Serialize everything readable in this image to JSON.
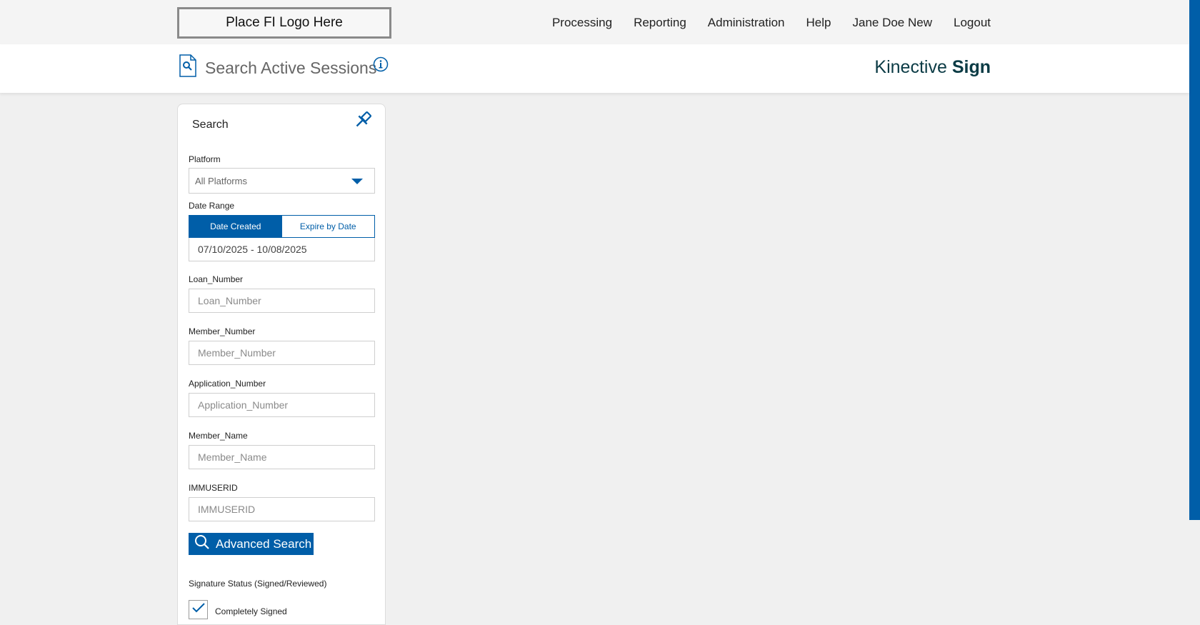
{
  "logo_text": "Place FI Logo Here",
  "nav": {
    "processing": "Processing",
    "reporting": "Reporting",
    "administration": "Administration",
    "help": "Help",
    "user": "Jane Doe New",
    "logout": "Logout"
  },
  "header": {
    "title": "Search Active Sessions",
    "brand_light": "Kinective",
    "brand_bold": "Sign"
  },
  "search_panel": {
    "title": "Search",
    "platform_label": "Platform",
    "platform_value": "All Platforms",
    "date_range_label": "Date Range",
    "date_created": "Date Created",
    "expire_by_date": "Expire by Date",
    "date_range_value": "07/10/2025 - 10/08/2025",
    "fields": {
      "loan_number": {
        "label": "Loan_Number",
        "placeholder": "Loan_Number"
      },
      "member_number": {
        "label": "Member_Number",
        "placeholder": "Member_Number"
      },
      "application_number": {
        "label": "Application_Number",
        "placeholder": "Application_Number"
      },
      "member_name": {
        "label": "Member_Name",
        "placeholder": "Member_Name"
      },
      "immuserid": {
        "label": "IMMUSERID",
        "placeholder": "IMMUSERID"
      }
    },
    "advanced_search": "Advanced Search",
    "signature_status_label": "Signature Status (Signed/Reviewed)",
    "completely_signed": "Completely Signed",
    "completely_signed_checked": true
  },
  "colors": {
    "accent": "#005ea8",
    "brand_text": "#0b3b45",
    "page_bg": "#f0f0f0"
  }
}
